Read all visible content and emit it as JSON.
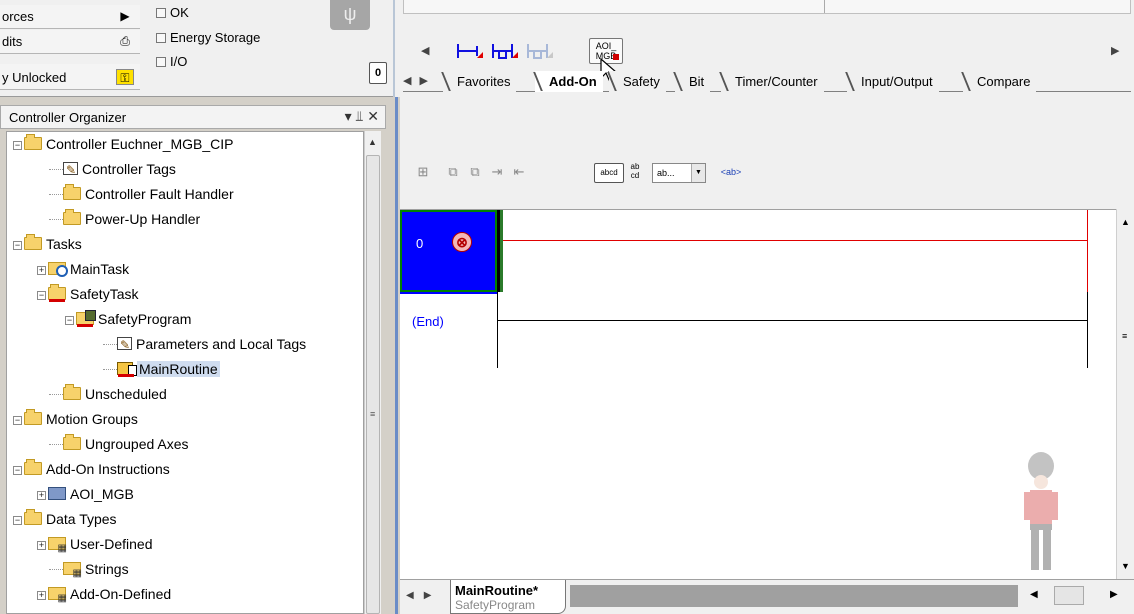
{
  "status_panel": {
    "rows": [
      {
        "label": "orces",
        "icon": "▶"
      },
      {
        "label": "dits",
        "icon": "⎙"
      },
      {
        "label": "y Unlocked",
        "icon": "⚿"
      }
    ],
    "indicators": [
      "OK",
      "Energy Storage",
      "I/O"
    ]
  },
  "toolbar": {
    "aoi_button_text": "AOI_\nMGB",
    "tabs": [
      "Favorites",
      "Add-On",
      "Safety",
      "Bit",
      "Timer/Counter",
      "Input/Output",
      "Compare"
    ],
    "active_tab": "Add-On"
  },
  "organizer": {
    "title": "Controller Organizer",
    "header_controls": "▾ ⫫ ✕",
    "tree": [
      {
        "label": "Controller Euchner_MGB_CIP",
        "icon": "folder",
        "depth": 0,
        "toggle": "−"
      },
      {
        "label": "Controller Tags",
        "icon": "page",
        "depth": 1
      },
      {
        "label": "Controller Fault Handler",
        "icon": "folder",
        "depth": 1
      },
      {
        "label": "Power-Up Handler",
        "icon": "folder",
        "depth": 1
      },
      {
        "label": "Tasks",
        "icon": "folder",
        "depth": 0,
        "toggle": "−"
      },
      {
        "label": "MainTask",
        "icon": "task",
        "depth": 1,
        "toggle": "+"
      },
      {
        "label": "SafetyTask",
        "icon": "folder-red",
        "depth": 1,
        "toggle": "−"
      },
      {
        "label": "SafetyProgram",
        "icon": "prog-red",
        "depth": 2,
        "toggle": "−"
      },
      {
        "label": "Parameters and Local Tags",
        "icon": "page",
        "depth": 3
      },
      {
        "label": "MainRoutine",
        "icon": "routine-red",
        "depth": 3,
        "selected": true
      },
      {
        "label": "Unscheduled",
        "icon": "folder",
        "depth": 1
      },
      {
        "label": "Motion Groups",
        "icon": "folder",
        "depth": 0,
        "toggle": "−"
      },
      {
        "label": "Ungrouped Axes",
        "icon": "folder",
        "depth": 1
      },
      {
        "label": "Add-On Instructions",
        "icon": "folder",
        "depth": 0,
        "toggle": "−"
      },
      {
        "label": "AOI_MGB",
        "icon": "aoi",
        "depth": 1,
        "toggle": "+"
      },
      {
        "label": "Data Types",
        "icon": "folder",
        "depth": 0,
        "toggle": "−"
      },
      {
        "label": "User-Defined",
        "icon": "udt",
        "depth": 1,
        "toggle": "+"
      },
      {
        "label": "Strings",
        "icon": "udt",
        "depth": 1
      },
      {
        "label": "Add-On-Defined",
        "icon": "udt",
        "depth": 1,
        "toggle": "+"
      }
    ]
  },
  "ladder": {
    "toolbar": {
      "icons": [
        "⊞",
        "⧉",
        "⧉",
        "⇥",
        "⇤"
      ],
      "btn_abcd": "abcd",
      "btn_abcd2": "ab\ncd",
      "combo_value": "ab...",
      "btn_ab": "<ab>"
    },
    "rungs": [
      {
        "number": "0",
        "has_error": true,
        "error_icon": "⊗"
      }
    ],
    "end_label": "(End)"
  },
  "bottom_tab": {
    "routine": "MainRoutine*",
    "program": "SafetyProgram"
  }
}
